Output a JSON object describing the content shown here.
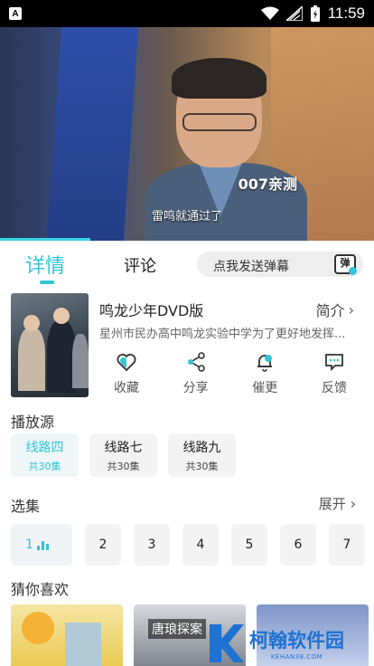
{
  "status_bar": {
    "time": "11:59",
    "app_badge": "A"
  },
  "video": {
    "watermark": "007亲测",
    "subtitle": "雷鸣就通过了"
  },
  "tabs": {
    "details": "详情",
    "comments": "评论"
  },
  "danmu": {
    "placeholder": "点我发送弹幕",
    "icon_label": "弹"
  },
  "show": {
    "title": "鸣龙少年DVD版",
    "intro_label": "简介",
    "description": "星州市民办高中鸣龙实验中学为了更好地发挥..."
  },
  "actions": [
    {
      "label": "收藏",
      "icon": "heart-icon"
    },
    {
      "label": "分享",
      "icon": "share-icon"
    },
    {
      "label": "催更",
      "icon": "bell-icon"
    },
    {
      "label": "反馈",
      "icon": "feedback-icon"
    }
  ],
  "sources_section": {
    "title": "播放源"
  },
  "sources": [
    {
      "name": "线路四",
      "count": "共30集",
      "active": true
    },
    {
      "name": "线路七",
      "count": "共30集",
      "active": false
    },
    {
      "name": "线路九",
      "count": "共30集",
      "active": false
    }
  ],
  "episodes_section": {
    "title": "选集",
    "expand_label": "展开"
  },
  "episodes": [
    "1",
    "2",
    "3",
    "4",
    "5",
    "6",
    "7"
  ],
  "recommend_section": {
    "title": "猜你喜欢"
  },
  "recommendations": [
    {
      "title": ""
    },
    {
      "title": "唐琅探案"
    },
    {
      "title": ""
    }
  ],
  "brand": {
    "name": "柯翰软件园",
    "domain": "KEHAN38.COM"
  },
  "colors": {
    "accent": "#30c6d6",
    "brand": "#1d72d2"
  }
}
